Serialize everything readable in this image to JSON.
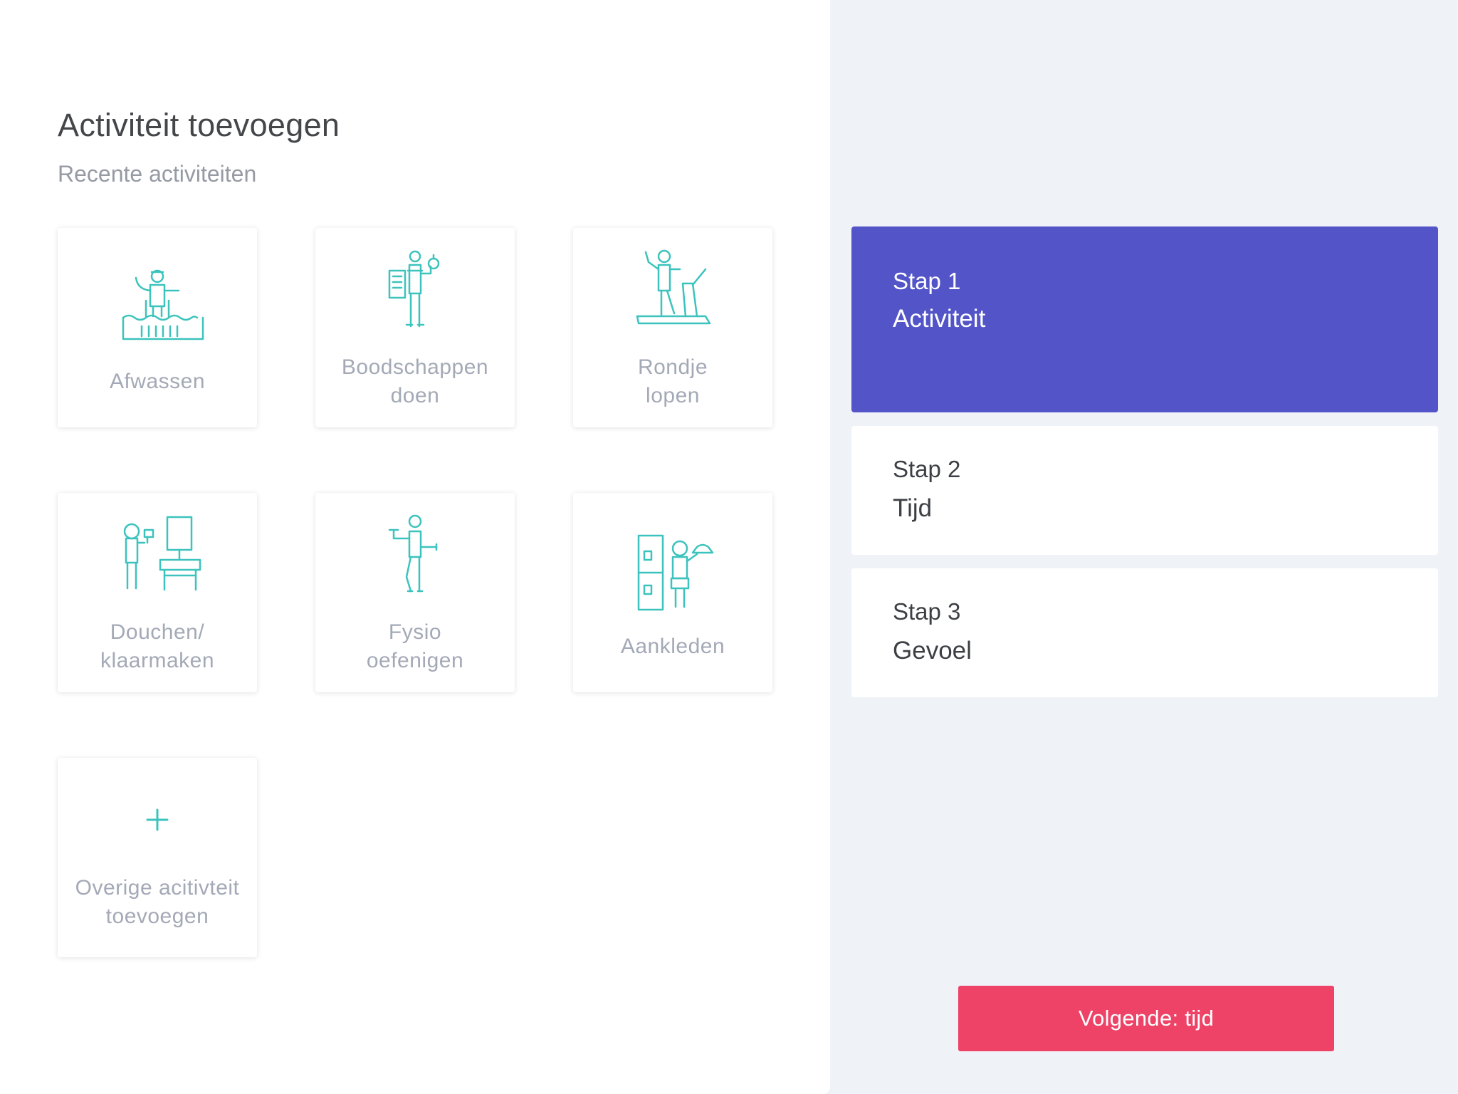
{
  "header": {
    "title": "Activiteit toevoegen",
    "subtitle": "Recente activiteiten"
  },
  "activities": [
    {
      "label": "Afwassen",
      "icon": "dishwashing-icon"
    },
    {
      "label": "Boodschappen\ndoen",
      "icon": "groceries-icon"
    },
    {
      "label": "Rondje\nlopen",
      "icon": "treadmill-walk-icon"
    },
    {
      "label": "Douchen/\nklaarmaken",
      "icon": "shower-getting-ready-icon"
    },
    {
      "label": "Fysio\noefenigen",
      "icon": "physio-exercise-icon"
    },
    {
      "label": "Aankleden",
      "icon": "dressing-icon"
    },
    {
      "label": "Overige acitivteit\ntoevoegen",
      "icon": "plus-icon"
    }
  ],
  "steps": [
    {
      "number": "Stap 1",
      "name": "Activiteit",
      "active": true
    },
    {
      "number": "Stap 2",
      "name": "Tijd",
      "active": false
    },
    {
      "number": "Stap 3",
      "name": "Gevoel",
      "active": false
    }
  ],
  "footer": {
    "next_label": "Volgende: tijd"
  },
  "colors": {
    "accent": "#5254c8",
    "icon_teal": "#3cc3bd",
    "cta": "#ee4266",
    "background": "#eff2f7"
  }
}
